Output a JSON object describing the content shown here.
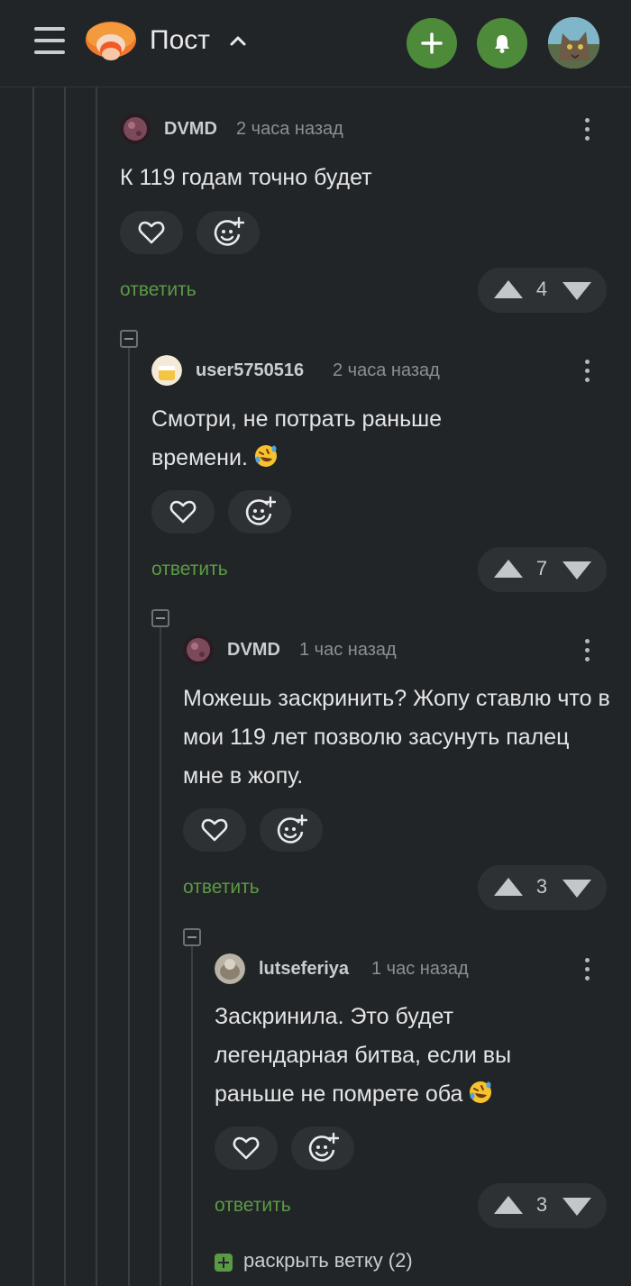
{
  "header": {
    "title": "Пост",
    "accent": "#4d8b3b"
  },
  "comments": [
    {
      "author": "DVMD",
      "time": "2 часа назад",
      "text": "К 119 годам точно будет",
      "votes": "4",
      "reply_label": "ответить"
    },
    {
      "author": "user5750516",
      "time": "2 часа назад",
      "text": "Смотри, не потрать раньше времени.",
      "votes": "7",
      "reply_label": "ответить"
    },
    {
      "author": "DVMD",
      "time": "1 час назад",
      "text": "Можешь заскринить? Жопу ставлю что в мои 119 лет позволю засунуть палец мне в жопу.",
      "votes": "3",
      "reply_label": "ответить"
    },
    {
      "author": "lutseferiya",
      "time": "1 час назад",
      "text": "Заскринила. Это будет легендарная битва, если вы раньше не помрете оба",
      "votes": "3",
      "reply_label": "ответить"
    }
  ],
  "expand_branch": "раскрыть ветку (2)",
  "icons": [
    "menu-icon",
    "plus-icon",
    "bell-icon",
    "heart-icon",
    "emoji-add-icon",
    "more-vertical-icon",
    "arrow-up-icon",
    "arrow-down-icon",
    "rofl-emoji"
  ]
}
